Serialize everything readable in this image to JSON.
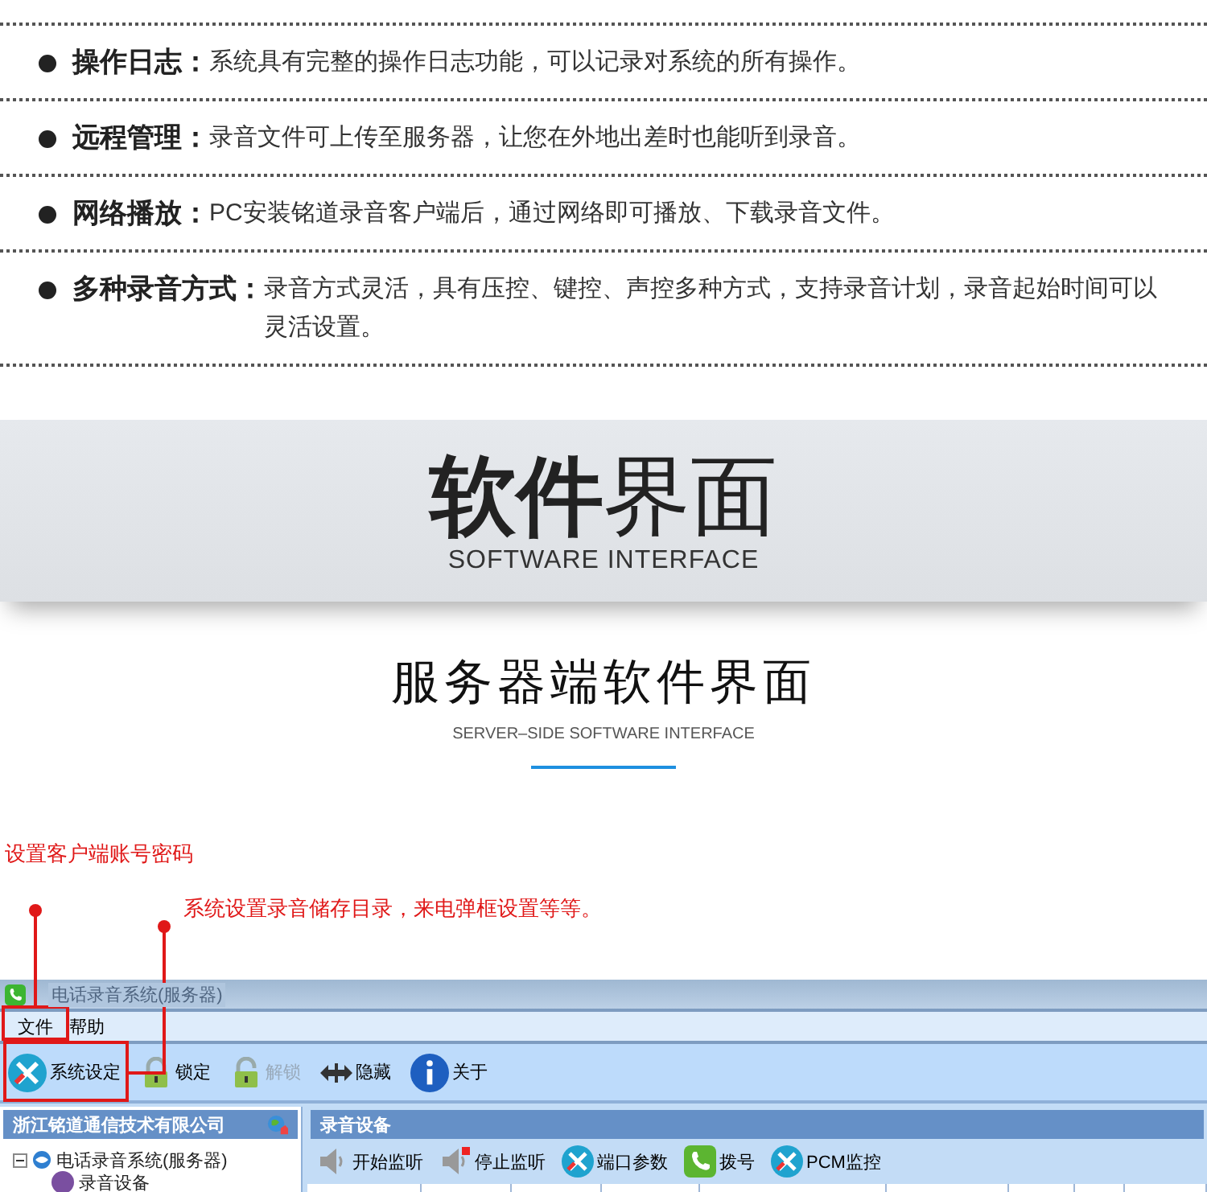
{
  "features": [
    {
      "label": "操作日志：",
      "text": "系统具有完整的操作日志功能，可以记录对系统的所有操作。"
    },
    {
      "label": "远程管理：",
      "text": "录音文件可上传至服务器，让您在外地出差时也能听到录音。"
    },
    {
      "label": "网络播放：",
      "text": "PC安装铭道录音客户端后，通过网络即可播放、下载录音文件。"
    },
    {
      "label": "多种录音方式：",
      "text": "录音方式灵活，具有压控、键控、声控多种方式，支持录音计划，录音起始时间可以灵活设置。"
    }
  ],
  "banner": {
    "title": "**软件**界面",
    "subtitle": "SOFTWARE INTERFACE"
  },
  "section": {
    "title": "服务器端软件界面",
    "subtitle": "SERVER–SIDE SOFTWARE INTERFACE"
  },
  "annotations": [
    {
      "text": "设置客户端账号密码"
    },
    {
      "text": "系统设置录音储存目录，来电弹框设置等等。"
    }
  ],
  "window": {
    "title": "电话录音系统(服务器)",
    "menu": [
      "文件",
      "帮助"
    ],
    "toolbar": [
      {
        "label": "系统设定",
        "kind": "tools",
        "disabled": false
      },
      {
        "label": "锁定",
        "kind": "lock",
        "disabled": false
      },
      {
        "label": "解锁",
        "kind": "unlock",
        "disabled": true
      },
      {
        "label": "隐藏",
        "kind": "arrows",
        "disabled": false
      },
      {
        "label": "关于",
        "kind": "info",
        "disabled": false
      }
    ],
    "left_panel": {
      "title": "浙江铭道通信技术有限公司",
      "tree": [
        {
          "label": "电话录音系统(服务器)",
          "expanded": true,
          "children": [
            {
              "label": "录音设备"
            }
          ]
        }
      ]
    },
    "right_panel": {
      "title": "录音设备",
      "toolbar": [
        {
          "label": "开始监听",
          "kind": "speaker"
        },
        {
          "label": "停止监听",
          "kind": "speaker-stop"
        },
        {
          "label": "端口参数",
          "kind": "tools"
        },
        {
          "label": "拨号",
          "kind": "phone"
        },
        {
          "label": "PCM监控",
          "kind": "tools"
        }
      ]
    }
  }
}
